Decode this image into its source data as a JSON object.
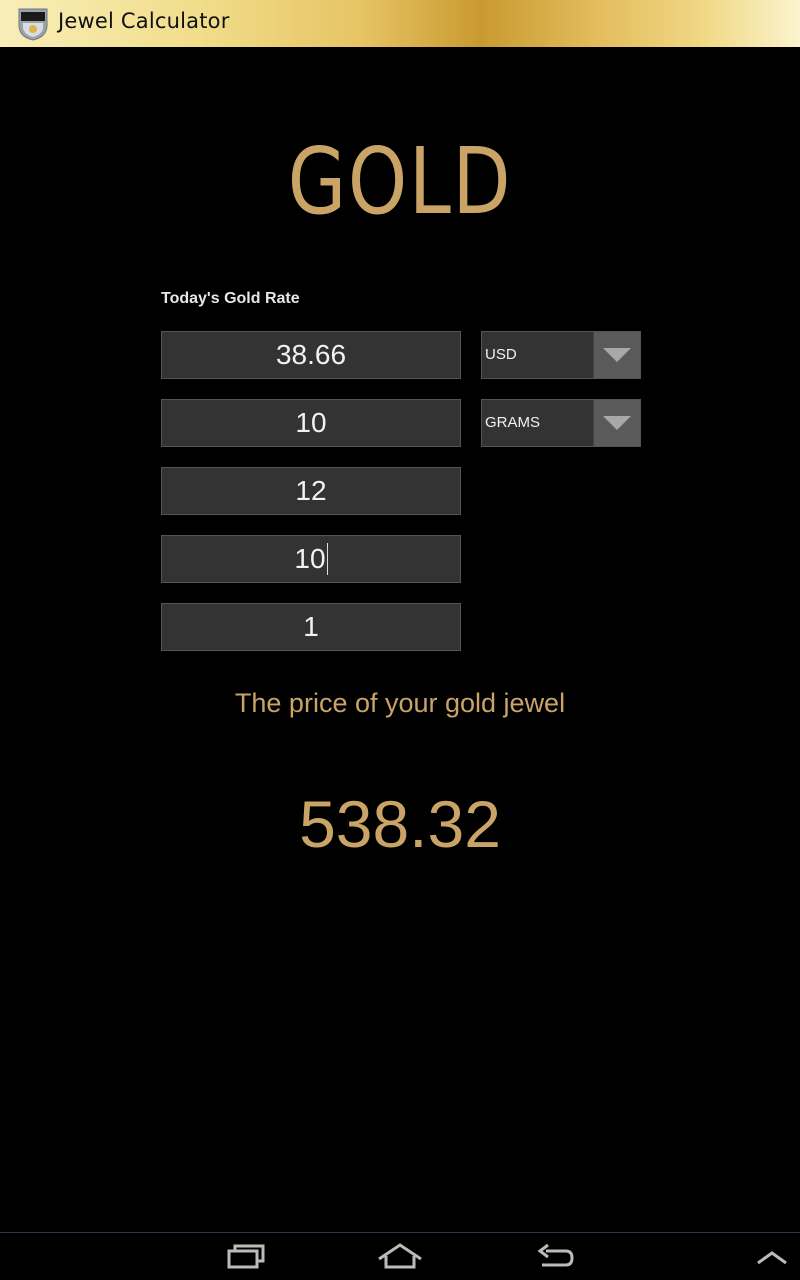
{
  "app": {
    "title": "Jewel Calculator",
    "icon_name": "jewel-calculator-logo-icon"
  },
  "screen": {
    "heading": "GOLD",
    "rate_label": "Today's Gold Rate"
  },
  "fields": {
    "rate": {
      "value": "38.66"
    },
    "weight": {
      "value": "10"
    },
    "field3": {
      "value": "12"
    },
    "field4": {
      "value": "10"
    },
    "field5": {
      "value": "1"
    }
  },
  "spinners": {
    "currency": {
      "selected": "USD"
    },
    "unit": {
      "selected": "GRAMS"
    }
  },
  "result": {
    "label": "The price of your gold jewel",
    "value": "538.32"
  },
  "nav": {
    "recent_icon": "recent-apps-icon",
    "home_icon": "home-icon",
    "back_icon": "back-icon",
    "menu_icon": "chevron-up-icon"
  },
  "colors": {
    "accent": "#c9a466",
    "field_bg": "#333333",
    "background": "#000000"
  }
}
